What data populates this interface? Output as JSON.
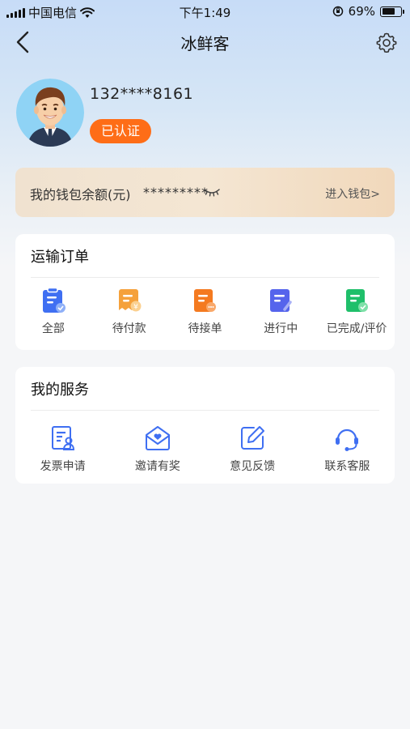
{
  "status_bar": {
    "carrier": "中国电信",
    "time": "下午1:49",
    "battery_percent": "69%",
    "battery_level": 0.69
  },
  "nav": {
    "title": "冰鲜客",
    "back_icon": "back-arrow-icon",
    "settings_icon": "gear-icon"
  },
  "profile": {
    "phone": "132****8161",
    "badge": "已认证"
  },
  "wallet": {
    "label": "我的钱包余额(元)",
    "masked_amount": "*********",
    "link": "进入钱包>"
  },
  "orders": {
    "title": "运输订单",
    "items": [
      {
        "label": "全部",
        "icon": "all-orders-icon",
        "color": "#3f6ff2"
      },
      {
        "label": "待付款",
        "icon": "pending-payment-icon",
        "color": "#f5a13b"
      },
      {
        "label": "待接单",
        "icon": "pending-accept-icon",
        "color": "#f47a20"
      },
      {
        "label": "进行中",
        "icon": "in-progress-icon",
        "color": "#5564ec"
      },
      {
        "label": "已完成/评价",
        "icon": "completed-icon",
        "color": "#1fbf6a"
      }
    ]
  },
  "services": {
    "title": "我的服务",
    "items": [
      {
        "label": "发票申请",
        "icon": "invoice-icon"
      },
      {
        "label": "邀请有奖",
        "icon": "invite-reward-icon"
      },
      {
        "label": "意见反馈",
        "icon": "feedback-icon"
      },
      {
        "label": "联系客服",
        "icon": "customer-service-icon"
      }
    ],
    "color": "#3f6ff2"
  }
}
